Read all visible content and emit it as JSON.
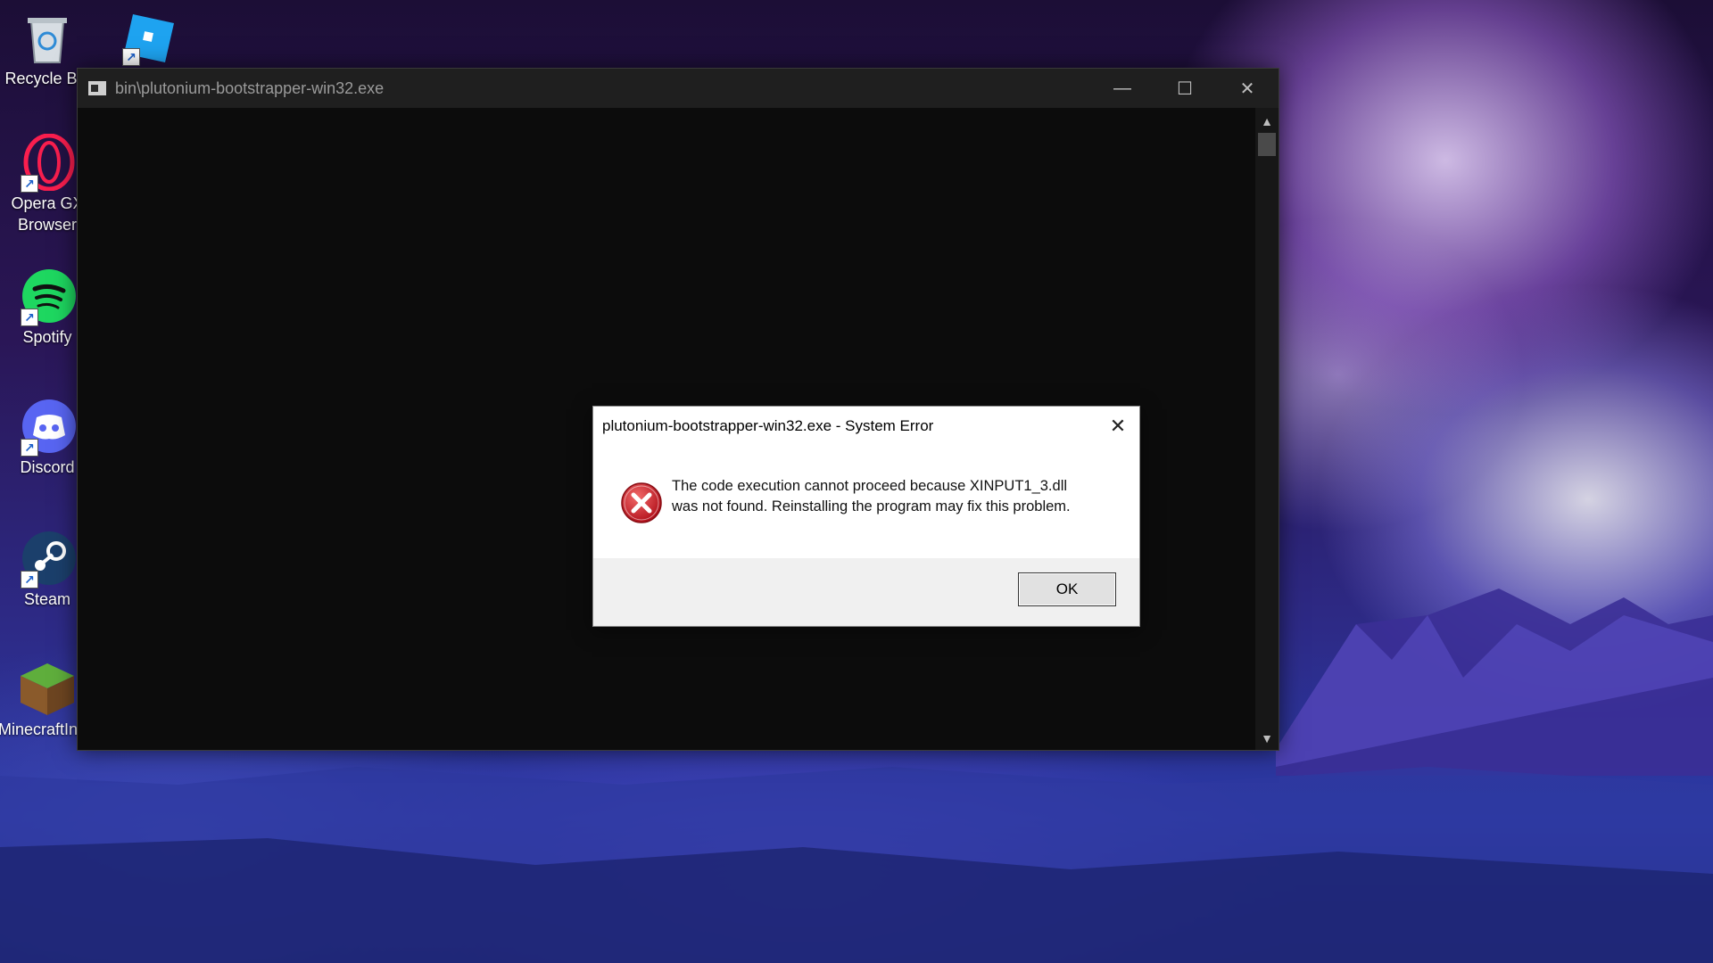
{
  "desktop": {
    "icons": [
      {
        "label": "Recycle Bin"
      },
      {
        "label": ""
      },
      {
        "label": "Opera GX Browser"
      },
      {
        "label": "Spotify"
      },
      {
        "label": "Discord"
      },
      {
        "label": "Steam"
      },
      {
        "label": "MinecraftInstaller"
      }
    ]
  },
  "console": {
    "title": "bin\\plutonium-bootstrapper-win32.exe",
    "minimize_glyph": "—",
    "maximize_glyph": "☐",
    "close_glyph": "✕",
    "scroll_up_glyph": "▲",
    "scroll_down_glyph": "▼"
  },
  "dialog": {
    "title": "plutonium-bootstrapper-win32.exe - System Error",
    "close_glyph": "✕",
    "message_line1": "The code execution cannot proceed because XINPUT1_3.dll",
    "message_line2": "was not found. Reinstalling the program may fix this problem.",
    "ok_label": "OK"
  },
  "colors": {
    "error_red": "#d21f2b",
    "console_bg": "#0c0c0c",
    "titlebar_bg": "#1f1f1f"
  }
}
